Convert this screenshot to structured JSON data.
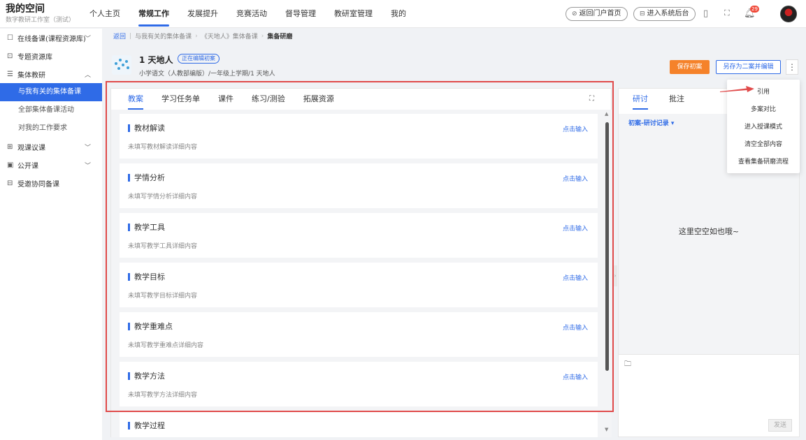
{
  "brand": {
    "title": "我的空间",
    "subtitle": "数字教研工作室（测试）"
  },
  "nav": [
    "个人主页",
    "常规工作",
    "发展提升",
    "竞赛活动",
    "督导管理",
    "教研室管理",
    "我的"
  ],
  "header_actions": {
    "portal": "返回门户首页",
    "backend": "进入系统后台",
    "bell_count": "29"
  },
  "sidebar": {
    "items": [
      {
        "label": "在线备课(课程资源库)",
        "icon": "☐",
        "chevron": "﹀"
      },
      {
        "label": "专题资源库",
        "icon": "⊡"
      },
      {
        "label": "集体教研",
        "icon": "☰",
        "chevron": "︿"
      }
    ],
    "sub_items": [
      "与我有关的集体备课",
      "全部集体备课活动",
      "对我的工作要求"
    ],
    "more_items": [
      {
        "label": "观课议课",
        "icon": "⊞",
        "chevron": "﹀"
      },
      {
        "label": "公开课",
        "icon": "▣",
        "chevron": "﹀"
      },
      {
        "label": "受邀协同备课",
        "icon": "⊟"
      }
    ]
  },
  "breadcrumb": {
    "back": "返回",
    "path1": "与我有关的集体备课",
    "path2": "《天地人》集体备课",
    "current": "集备研磨"
  },
  "lesson": {
    "title": "1 天地人",
    "badge": "正在编辑初案",
    "subtitle": "小学语文（人教部编版）/一年级上学期/1 天地人"
  },
  "buttons": {
    "save": "保存初案",
    "save_as": "另存为二案并编辑",
    "more": "⋮"
  },
  "tabs": [
    "教案",
    "学习任务单",
    "课件",
    "练习/测验",
    "拓展资源"
  ],
  "sections": [
    {
      "title": "教材解读",
      "desc": "未填写教材解读详细内容",
      "action": "点击输入"
    },
    {
      "title": "学情分析",
      "desc": "未填写学情分析详细内容",
      "action": "点击输入"
    },
    {
      "title": "教学工具",
      "desc": "未填写教学工具详细内容",
      "action": "点击输入"
    },
    {
      "title": "教学目标",
      "desc": "未填写教学目标详细内容",
      "action": "点击输入"
    },
    {
      "title": "教学重难点",
      "desc": "未填写教学重难点详细内容",
      "action": "点击输入"
    },
    {
      "title": "教学方法",
      "desc": "未填写教学方法详细内容",
      "action": "点击输入"
    },
    {
      "title": "教学过程",
      "desc": "",
      "action": ""
    }
  ],
  "right_panel": {
    "tabs": [
      "研讨",
      "批注"
    ],
    "record_dropdown": "初案-研讨记录 ▾",
    "empty_text": "这里空空如也哦~",
    "send": "发送"
  },
  "dropdown_menu": [
    "引用",
    "多案对比",
    "进入授课模式",
    "清空全部内容",
    "查看集备研磨流程"
  ],
  "colors": {
    "accent": "#2f6be7",
    "orange": "#f5822a",
    "highlight_red": "#e04a4a"
  }
}
